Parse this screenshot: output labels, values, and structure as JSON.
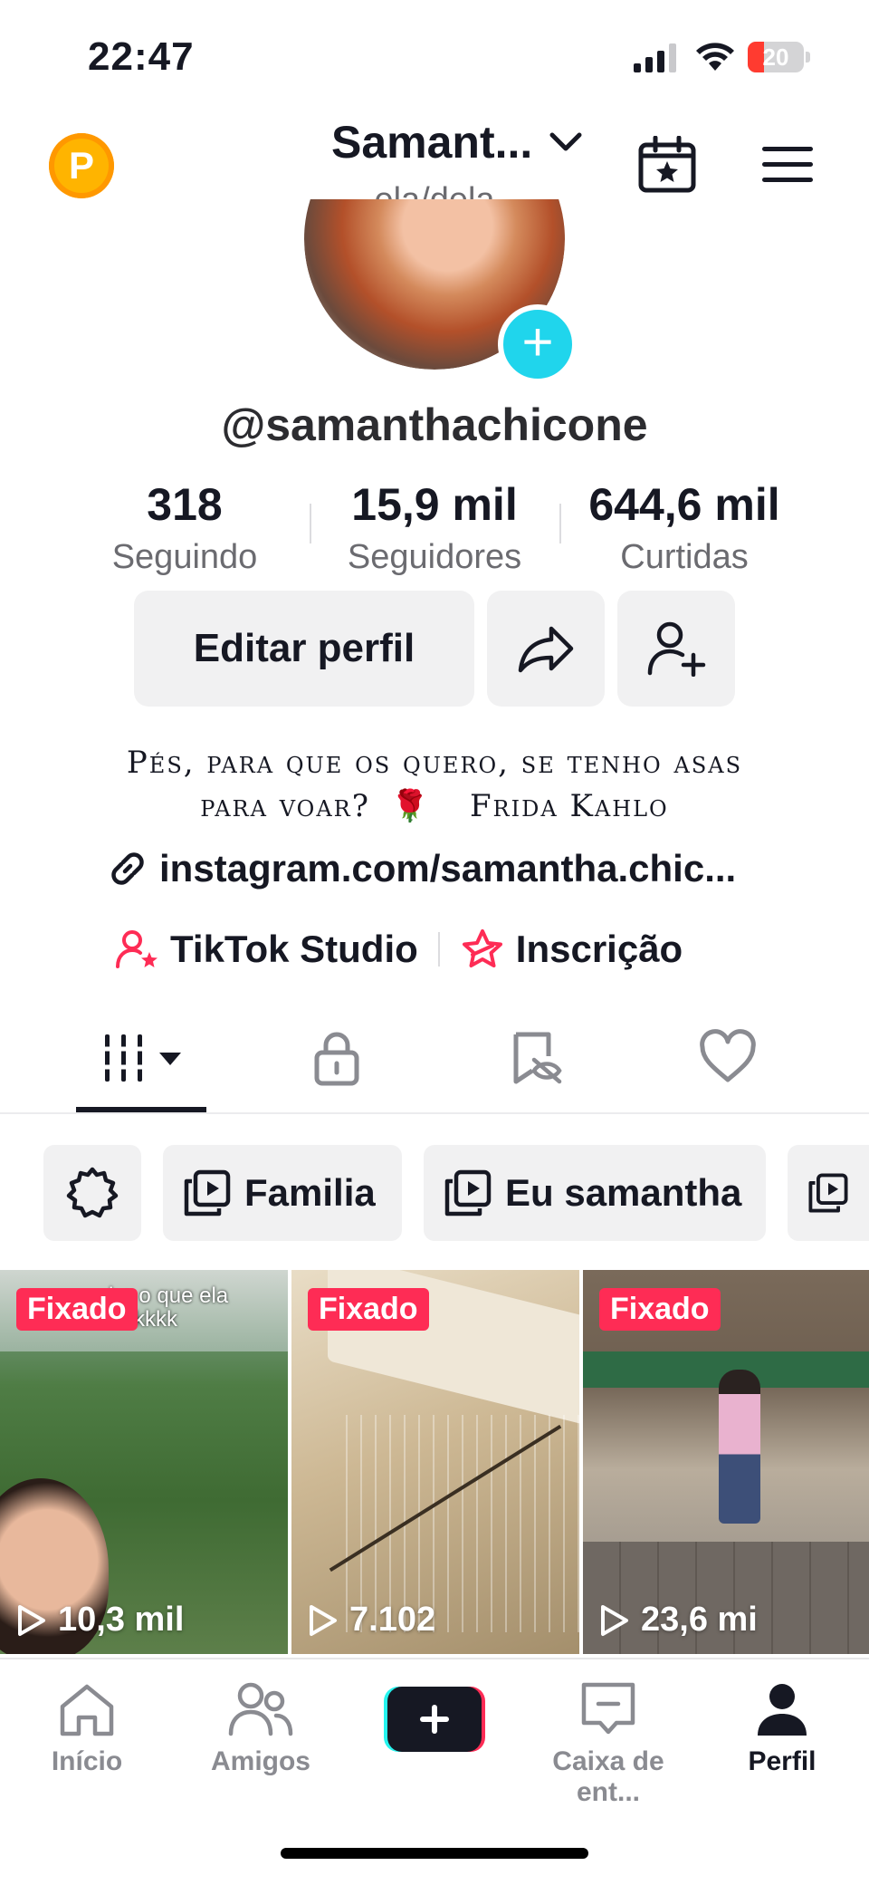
{
  "status_bar": {
    "time": "22:47",
    "battery": "20"
  },
  "header": {
    "coin_label": "P",
    "display_name": "Samant...",
    "pronouns": "ela/dela"
  },
  "profile": {
    "handle": "@samanthachicone"
  },
  "stats": [
    {
      "value": "318",
      "label": "Seguindo"
    },
    {
      "value": "15,9 mil",
      "label": "Seguidores"
    },
    {
      "value": "644,6 mil",
      "label": "Curtidas"
    }
  ],
  "actions": {
    "edit_profile": "Editar perfil"
  },
  "bio": {
    "line1": "Pés, para que os quero, se tenho asas",
    "line2a": "para voar?",
    "emoji": "🌹",
    "line2b": "Frida Kahlo"
  },
  "link": "instagram.com/samantha.chic...",
  "shortcuts": {
    "studio": "TikTok Studio",
    "subscription": "Inscrição"
  },
  "playlists": [
    "Familia",
    "Eu samantha"
  ],
  "videos": [
    {
      "pinned": "Fixado",
      "views": "10,3 mil",
      "overlay": "...be o que ela ...Kkkkkk"
    },
    {
      "pinned": "Fixado",
      "views": "7.102"
    },
    {
      "pinned": "Fixado",
      "views": "23,6 mi"
    }
  ],
  "nav": {
    "home": "Início",
    "friends": "Amigos",
    "inbox": "Caixa de ent...",
    "profile": "Perfil"
  },
  "colors": {
    "accent": "#fe2c55",
    "cyan": "#20d5ec",
    "coin": "#ffb400"
  }
}
